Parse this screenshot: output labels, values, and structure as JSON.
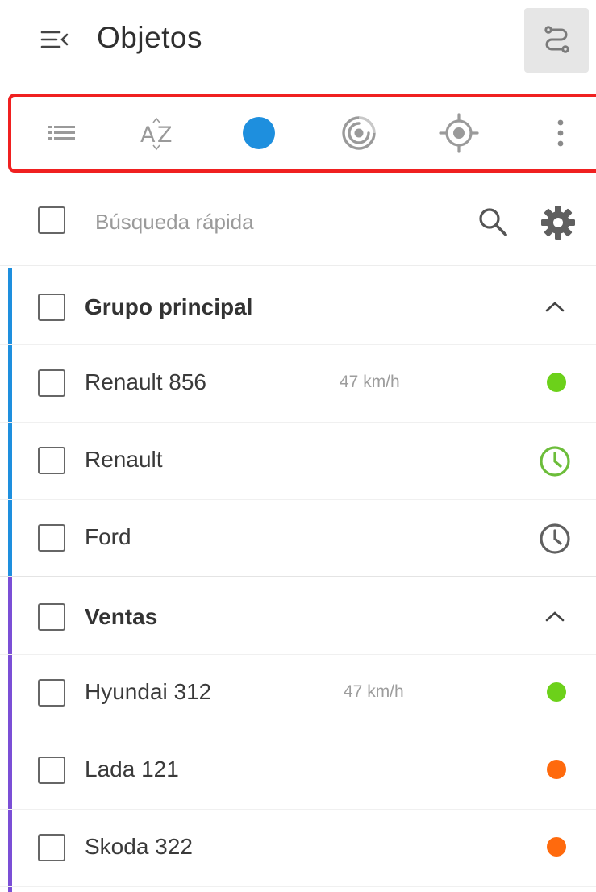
{
  "header": {
    "title": "Objetos",
    "menu_icon": "collapse-menu-icon",
    "route_icon": "route-icon"
  },
  "toolbar": {
    "icons": [
      "list-icon",
      "sort-az-icon",
      "status-dot-icon",
      "signal-icon",
      "locate-icon",
      "more-vert-icon"
    ],
    "active_color": "#1e8fde"
  },
  "search": {
    "placeholder": "Búsqueda rápida",
    "search_icon": "search-icon",
    "settings_icon": "gear-icon"
  },
  "groups": [
    {
      "name": "Grupo principal",
      "color": "#1e8fde",
      "items": [
        {
          "name": "Renault 856",
          "speed": "47 km/h",
          "status": "moving",
          "status_color": "#6cd11a"
        },
        {
          "name": "Renault",
          "speed": "",
          "status": "clock-green",
          "status_color": "#6cbd3a"
        },
        {
          "name": "Ford",
          "speed": "",
          "status": "clock-gray",
          "status_color": "#606060"
        }
      ]
    },
    {
      "name": "Ventas",
      "color": "#7b4fd6",
      "items": [
        {
          "name": "Hyundai 312",
          "speed": "47 km/h",
          "status": "moving",
          "status_color": "#6cd11a"
        },
        {
          "name": "Lada 121",
          "speed": "",
          "status": "stopped",
          "status_color": "#ff6a0d"
        },
        {
          "name": "Skoda 322",
          "speed": "",
          "status": "stopped",
          "status_color": "#ff6a0d"
        }
      ]
    }
  ]
}
